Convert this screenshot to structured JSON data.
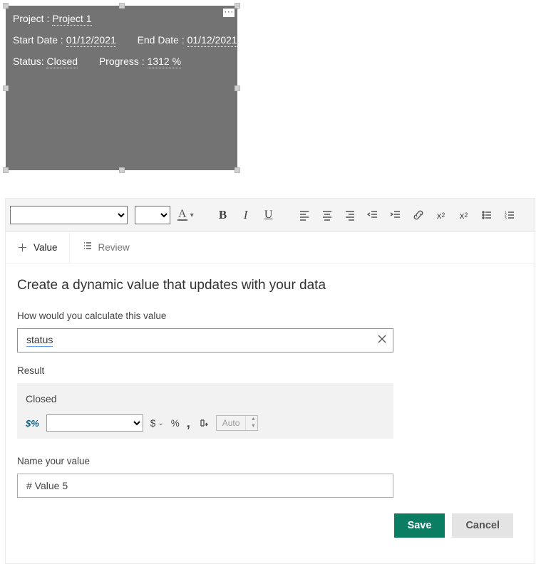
{
  "card": {
    "project_label": "Project : ",
    "project_value": "Project 1",
    "start_label": "Start Date : ",
    "start_value": "01/12/2021",
    "end_label": "End Date : ",
    "end_value": "01/12/2021",
    "status_label": "Status: ",
    "status_value": "Closed",
    "progress_label": "Progress : ",
    "progress_value": "1312 %",
    "menu_glyph": "···"
  },
  "toolbar": {
    "font_family": "",
    "font_size": ""
  },
  "tabs": {
    "value_label": "Value",
    "review_label": "Review"
  },
  "pane": {
    "heading": "Create a dynamic value that updates with your data",
    "formula_label": "How would you calculate this value",
    "formula_value": "status",
    "result_label": "Result",
    "result_value": "Closed",
    "format_prefix": "$%",
    "currency_glyph": "$",
    "percent_glyph": "%",
    "comma_glyph": ",",
    "auto_label": "Auto",
    "name_label": "Name your value",
    "name_value": "# Value 5"
  },
  "footer": {
    "save_label": "Save",
    "cancel_label": "Cancel"
  }
}
